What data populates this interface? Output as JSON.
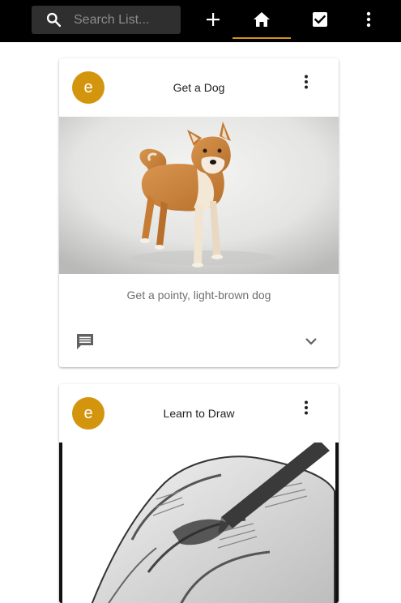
{
  "toolbar": {
    "search_placeholder": "Search List...",
    "icons": {
      "search": "search-icon",
      "add": "plus-icon",
      "home": "home-icon",
      "done": "checkbox-icon",
      "more": "more-vert-icon"
    },
    "active_tab": "home",
    "accent_color": "#d4950e",
    "background_color": "#000000"
  },
  "cards": [
    {
      "avatar_letter": "e",
      "title": "Get a Dog",
      "image_icon": "shiba-dog-photo",
      "description": "Get a pointy, light-brown dog",
      "icons": {
        "menu": "more-vert-icon",
        "comment": "comment-icon",
        "expand": "chevron-down-icon"
      }
    },
    {
      "avatar_letter": "e",
      "title": "Learn to Draw",
      "image_icon": "pencil-sketch-hand-drawing",
      "icons": {
        "menu": "more-vert-icon"
      }
    }
  ],
  "colors": {
    "avatar": "#d4950e",
    "card_text": "#222222",
    "description_text": "#6f6f6f",
    "icon_gray": "#616161"
  }
}
